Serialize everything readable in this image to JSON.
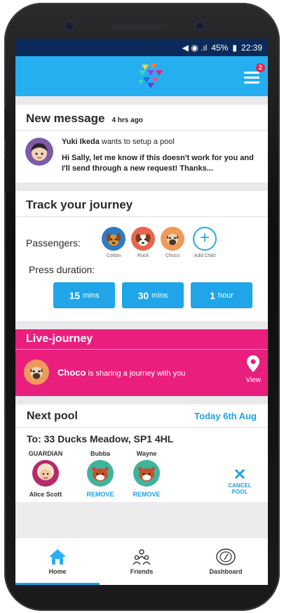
{
  "status": {
    "icons": "◀ ◉ .ıl",
    "battery": "45%",
    "time": "22:39"
  },
  "header": {
    "notif_count": "2"
  },
  "new_message": {
    "title": "New message",
    "time": "4 hrs ago",
    "sender": "Yuki Ikeda",
    "action": "wants to setup a pool",
    "body": "Hi Sally, let me know if this doesn't work for you and I'll send through a new request! Thanks..."
  },
  "track": {
    "title": "Track your journey",
    "passengers_label": "Passengers:",
    "passengers": [
      {
        "name": "Cotton",
        "color": "#2e7bc4"
      },
      {
        "name": "Rock",
        "color": "#e8654f"
      },
      {
        "name": "Choco",
        "color": "#ef9a5a"
      }
    ],
    "add_child": "Add Child",
    "duration_label": "Press duration:",
    "durations": [
      {
        "value": "15",
        "unit": "mins"
      },
      {
        "value": "30",
        "unit": "mins"
      },
      {
        "value": "1",
        "unit": "hour"
      }
    ]
  },
  "live": {
    "title": "Live-journey",
    "name": "Choco",
    "text": "is sharing a journey with you",
    "view": "View"
  },
  "next_pool": {
    "title": "Next pool",
    "date": "Today 6th Aug",
    "address": "To: 33 Ducks Meadow, SP1 4HL",
    "guardian_label": "GUARDIAN",
    "guardian_name": "Alice Scott",
    "members": [
      {
        "name": "Bubba",
        "action": "REMOVE"
      },
      {
        "name": "Wayne",
        "action": "REMOVE"
      }
    ],
    "cancel": "CANCEL POOL"
  },
  "tabs": [
    {
      "label": "Home",
      "icon": "home-icon"
    },
    {
      "label": "Friends",
      "icon": "friends-icon"
    },
    {
      "label": "Dashboard",
      "icon": "dashboard-icon"
    }
  ],
  "colors": {
    "brand": "#25aff0",
    "live": "#e91e7d",
    "accent": "#1e9fe5"
  }
}
